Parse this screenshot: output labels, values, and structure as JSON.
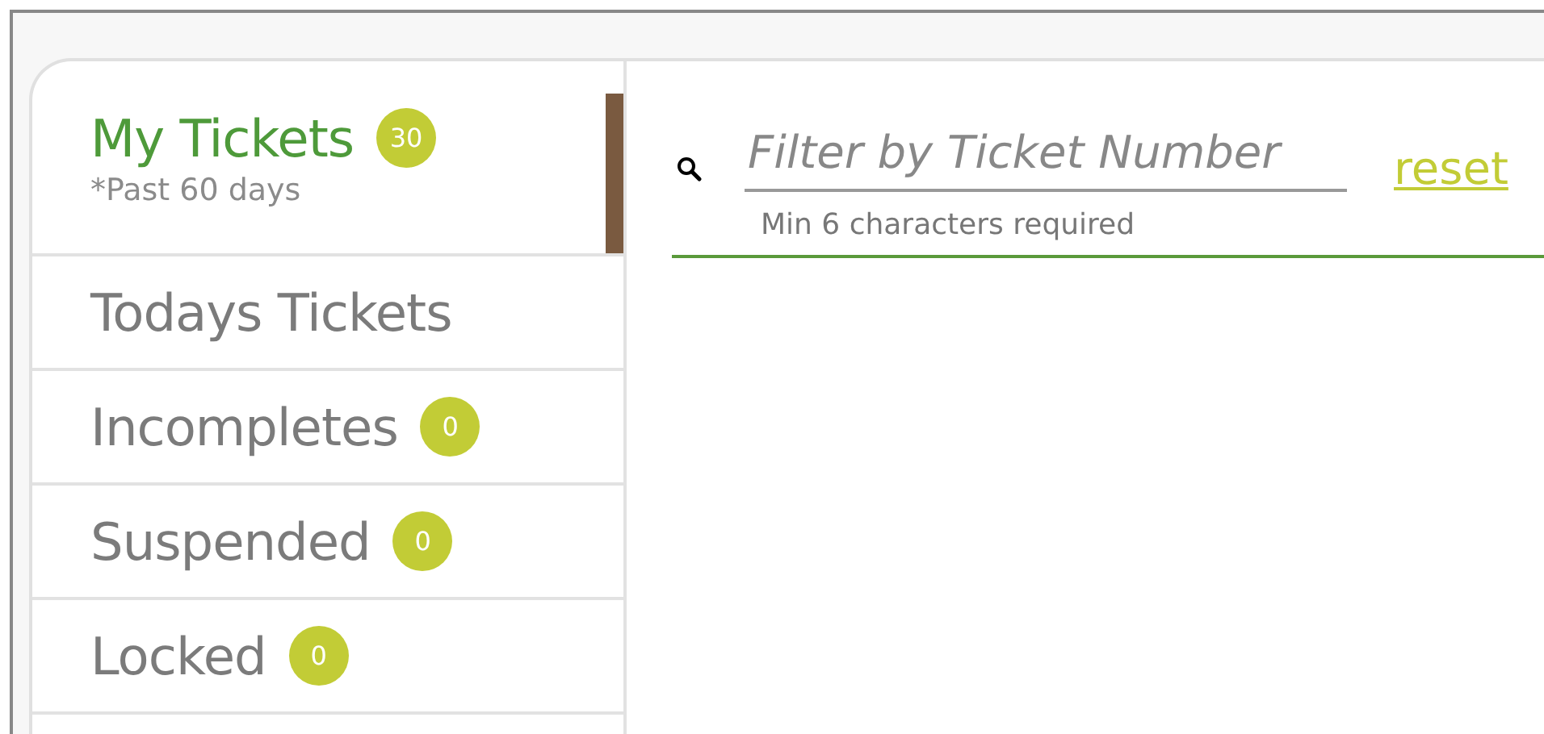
{
  "sidebar": {
    "items": [
      {
        "label": "My Tickets",
        "badge": "30",
        "note": "*Past 60 days",
        "selected": true
      },
      {
        "label": "Todays Tickets",
        "selected": false
      },
      {
        "label": "Incompletes",
        "badge": "0",
        "selected": false
      },
      {
        "label": "Suspended",
        "badge": "0",
        "selected": false
      },
      {
        "label": "Locked",
        "badge": "0",
        "selected": false
      }
    ]
  },
  "filter": {
    "placeholder": "Filter by Ticket Number",
    "hint": "Min 6 characters required",
    "reset": "reset"
  }
}
